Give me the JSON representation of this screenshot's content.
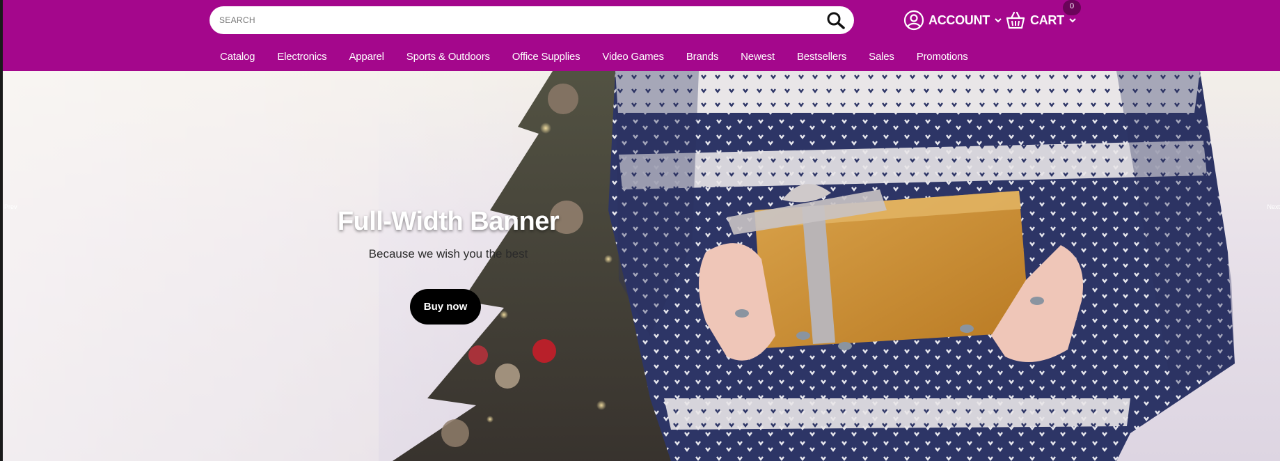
{
  "header": {
    "search_placeholder": "SEARCH",
    "account_label": "ACCOUNT",
    "cart_label": "CART",
    "cart_count": "0",
    "colors": {
      "background": "#a4078c",
      "badge": "#6a0459"
    }
  },
  "nav": {
    "items": [
      "Catalog",
      "Electronics",
      "Apparel",
      "Sports & Outdoors",
      "Office Supplies",
      "Video Games",
      "Brands",
      "Newest",
      "Bestsellers",
      "Sales",
      "Promotions"
    ]
  },
  "banner": {
    "title": "Full-Width Banner",
    "subtitle": "Because we wish you the best",
    "button_label": "Buy now",
    "prev_label": "Prev",
    "next_label": "Next"
  },
  "icons": {
    "search": "search-icon",
    "account": "user-circle-icon",
    "cart": "basket-icon",
    "chevron": "chevron-down-icon"
  }
}
